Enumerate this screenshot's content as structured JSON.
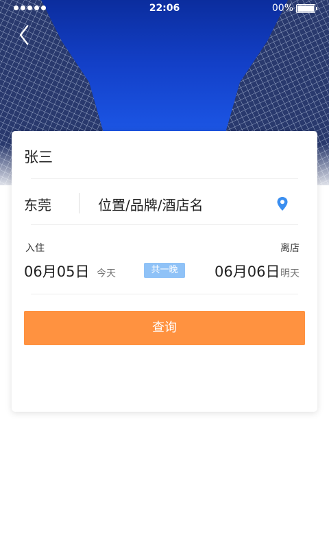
{
  "status_bar": {
    "time": "22:06",
    "battery_text": "00%"
  },
  "header": {
    "back_icon": "chevron-left-icon"
  },
  "form": {
    "guest_name": "张三",
    "city": "东莞",
    "search_placeholder": "位置/品牌/酒店名",
    "location_icon": "map-pin-icon",
    "location_icon_color": "#3a8ef0",
    "checkin_label": "入住",
    "checkout_label": "离店",
    "checkin_date": "06月05日",
    "checkin_relative": "今天",
    "nights_badge": "共一晚",
    "checkout_date": "06月06日",
    "checkout_relative": "明天",
    "query_button": "查询",
    "accent_color": "#ff9240"
  }
}
